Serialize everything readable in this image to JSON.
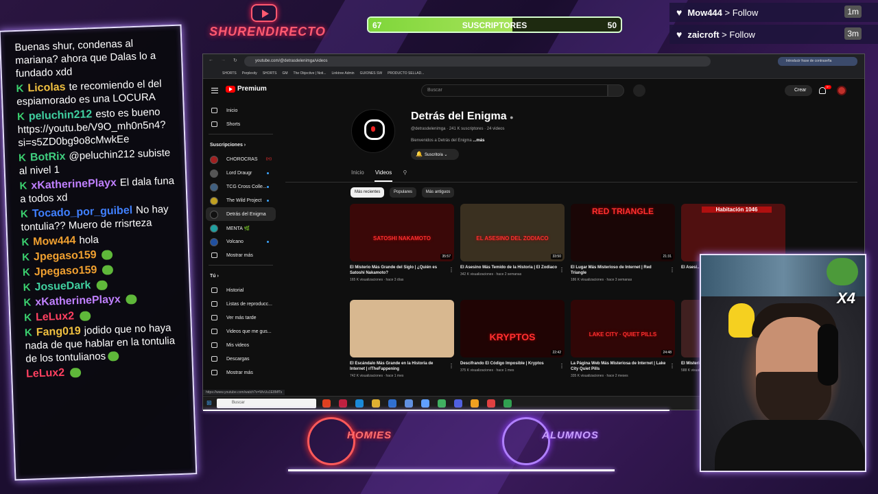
{
  "overlay": {
    "channel_logo": "SHURENDIRECTO",
    "sub_bar": {
      "left": "67",
      "label": "SUSCRIPTORES",
      "right": "50",
      "progress": 0.57
    },
    "follows": [
      {
        "user": "Mow444",
        "action": "> Follow",
        "time": "1m"
      },
      {
        "user": "zaicroft",
        "action": "> Follow",
        "time": "3m"
      }
    ],
    "badge_homies": "HOMIES",
    "badge_alumnos": "ALUMNOS",
    "cam_multiplier": "X4"
  },
  "chat": [
    {
      "user": "",
      "text": "Buenas shur, condenas al mariana? ahora que Dalas lo a fundado xdd",
      "color": "#ffffff",
      "badge": false,
      "emote": false
    },
    {
      "user": "Licolas",
      "text": "te recomiendo el del espiamorado es una LOCURA",
      "color": "#f0c040",
      "badge": true,
      "emote": false
    },
    {
      "user": "peluchin212",
      "text": "esto es bueno https://youtu.be/V9O_mh0n5n4?si=s5ZD0bg9o8cMwkEe",
      "color": "#40d0a0",
      "badge": true,
      "emote": false
    },
    {
      "user": "BotRix",
      "text": "@peluchin212 subiste al nivel 1",
      "color": "#40d080",
      "badge": true,
      "emote": false
    },
    {
      "user": "xKatherinePlayx",
      "text": "El dala funa a todos xd",
      "color": "#c080ff",
      "badge": true,
      "emote": false
    },
    {
      "user": "Tocado_por_guibel",
      "text": "No hay tontulia?? Muero de rrisrteza",
      "color": "#4080ff",
      "badge": true,
      "emote": false
    },
    {
      "user": "Mow444",
      "text": "hola",
      "color": "#f0a030",
      "badge": true,
      "emote": false
    },
    {
      "user": "Jpegaso159",
      "text": "",
      "color": "#f0a030",
      "badge": true,
      "emote": true
    },
    {
      "user": "Jpegaso159",
      "text": "",
      "color": "#f0a030",
      "badge": true,
      "emote": true
    },
    {
      "user": "JosueDark",
      "text": "",
      "color": "#40d0a0",
      "badge": true,
      "emote": true
    },
    {
      "user": "xKatherinePlayx",
      "text": "",
      "color": "#c080ff",
      "badge": true,
      "emote": true
    },
    {
      "user": "LeLux2",
      "text": "",
      "color": "#ff4060",
      "badge": true,
      "emote": true
    },
    {
      "user": "Fang019",
      "text": "jodido que no haya nada de que hablar en la tontulia de los tontulianos",
      "color": "#f0c040",
      "badge": true,
      "emote": true
    },
    {
      "user": "LeLux2",
      "text": "",
      "color": "#ff4060",
      "badge": false,
      "emote": true
    }
  ],
  "browser": {
    "url": "youtube.com/@detrasdelenimga/videos",
    "translate_chip": "Introducir frase de contraseña",
    "bookmarks": [
      "SHORTS",
      "Perplexity",
      "SHORTS",
      "GM",
      "The Objective | Noti...",
      "Linktree Admin",
      "GUIONES SW",
      "PRODUCTO SELLAD..."
    ],
    "status_url": "https://www.youtube.com/watch?v=WvUu1E8MfTs",
    "taskbar_search": "Buscar"
  },
  "youtube": {
    "brand": "Premium",
    "search_placeholder": "Buscar",
    "create_label": "Crear",
    "notif_count": "9+",
    "sidebar": {
      "main": [
        {
          "label": "Inicio",
          "icon": "home-icon"
        },
        {
          "label": "Shorts",
          "icon": "shorts-icon"
        }
      ],
      "subs_header": "Suscripciones",
      "subs": [
        {
          "label": "CHOROCRAS",
          "color": "#a02020",
          "live": true,
          "dot": false
        },
        {
          "label": "Lord Draugr",
          "color": "#555555",
          "live": false,
          "dot": true
        },
        {
          "label": "TCG Cross Colle...",
          "color": "#406080",
          "live": false,
          "dot": true
        },
        {
          "label": "The Wild Project",
          "color": "#c0a020",
          "live": false,
          "dot": true
        },
        {
          "label": "Detrás del Enigma",
          "color": "#111111",
          "live": false,
          "dot": false,
          "active": true
        },
        {
          "label": "MENTA 🌿",
          "color": "#20a0a0",
          "live": false,
          "dot": false
        },
        {
          "label": "Volcano",
          "color": "#2050a0",
          "live": false,
          "dot": true
        },
        {
          "label": "Mostrar más",
          "color": "",
          "live": false,
          "dot": false
        }
      ],
      "you_header": "Tú",
      "you": [
        {
          "label": "Historial"
        },
        {
          "label": "Listas de reproducc..."
        },
        {
          "label": "Ver más tarde"
        },
        {
          "label": "Videos que me gus..."
        },
        {
          "label": "Mis videos"
        },
        {
          "label": "Descargas"
        },
        {
          "label": "Mostrar más"
        }
      ]
    },
    "channel": {
      "name": "Detrás del Enigma",
      "handle_meta": "@detrasdelenimga · 241 K suscriptores · 24 videos",
      "description": "Bienvenidos a Detrás del Enigma",
      "more": "...más",
      "subscribe": "Suscrito/a"
    },
    "tabs": [
      "Inicio",
      "Videos"
    ],
    "chips": [
      "Más recientes",
      "Populares",
      "Más antiguos"
    ],
    "videos": [
      {
        "title": "El Misterio Más Grande del Siglo | ¿Quién es Satoshi Nakamoto?",
        "meta": "165 K visualizaciones · hace 3 días",
        "duration": "35:57",
        "thumb_text": "SATOSHI NAKAMOTO",
        "bg": "#3a0808"
      },
      {
        "title": "El Asesino Más Temido de la Historia | El Zodiaco",
        "meta": "342 K visualizaciones · hace 2 semanas",
        "duration": "33:50",
        "thumb_text": "EL ASESINO DEL ZODIACO",
        "bg": "#3a3020"
      },
      {
        "title": "El Lugar Más Misterioso de Internet | Red Triangle",
        "meta": "186 K visualizaciones · hace 3 semanas",
        "duration": "21:31",
        "thumb_text": "RED TRIANGLE",
        "bg": "#1a0606"
      },
      {
        "title": "El Asesi... Caso de...",
        "meta": "",
        "duration": "",
        "thumb_text": "Habitación 1046",
        "bg": "#501010"
      },
      {
        "title": "El Escándalo Más Grande en la Historia de Internet | r/TheFappening",
        "meta": "742 K visualizaciones · hace 1 mes",
        "duration": "",
        "thumb_text": "",
        "bg": "#d8b890"
      },
      {
        "title": "Descifrando El Código Imposible | Kryptos",
        "meta": "375 K visualizaciones · hace 1 mes",
        "duration": "22:42",
        "thumb_text": "KRYPTOS",
        "bg": "#200404"
      },
      {
        "title": "La Página Web Más Misteriosa de Internet | Lake City Quiet Pills",
        "meta": "335 K visualizaciones · hace 2 meses",
        "duration": "24:48",
        "thumb_text": "LAKE CITY · QUIET PILLS",
        "bg": "#300606"
      },
      {
        "title": "El Misterio... Estados...",
        "meta": "588 K visualizaciones",
        "duration": "",
        "thumb_text": "",
        "bg": "#402020"
      }
    ]
  }
}
